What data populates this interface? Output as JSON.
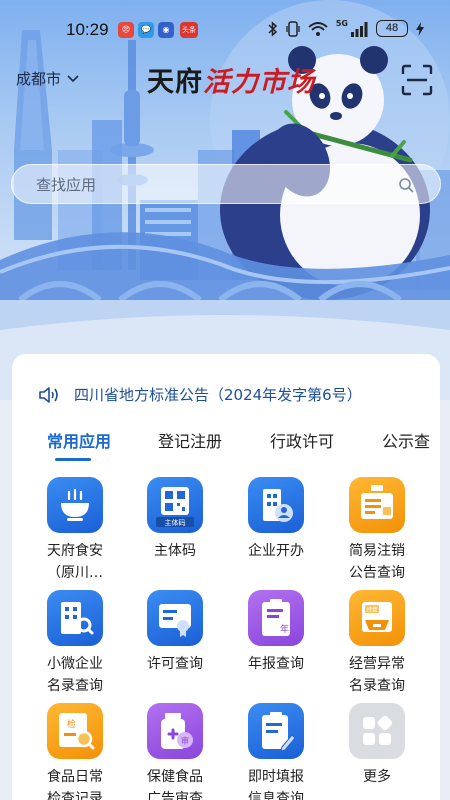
{
  "status_bar": {
    "time": "10:29",
    "notification_badges": [
      "",
      "",
      "",
      "头条"
    ],
    "network": "5G",
    "battery": "48"
  },
  "header": {
    "city": "成都市",
    "brand_black": "天府",
    "brand_red": "活力市场"
  },
  "search": {
    "placeholder": "查找应用"
  },
  "announcement": {
    "text": "四川省地方标准公告（2024年发字第6号）"
  },
  "tabs": [
    {
      "label": "常用应用",
      "active": true
    },
    {
      "label": "登记注册",
      "active": false
    },
    {
      "label": "行政许可",
      "active": false
    },
    {
      "label": "公示查",
      "active": false
    }
  ],
  "apps": [
    {
      "label": "天府食安\n（原川…",
      "icon": "food-bowl-icon",
      "color": "#2f7ee8"
    },
    {
      "label": "主体码",
      "icon": "qr-code-icon",
      "icon_text": "主体码",
      "color": "#2f7ee8"
    },
    {
      "label": "企业开办",
      "icon": "building-person-icon",
      "color": "#2f7ee8"
    },
    {
      "label": "简易注销\n公告查询",
      "icon": "signboard-icon",
      "color": "#f7a01d"
    },
    {
      "label": "小微企业\n名录查询",
      "icon": "building-search-icon",
      "color": "#2f7ee8"
    },
    {
      "label": "许可查询",
      "icon": "certificate-icon",
      "color": "#2f7ee8"
    },
    {
      "label": "年报查询",
      "icon": "annual-report-icon",
      "icon_text": "年",
      "color": "#9b59e6"
    },
    {
      "label": "经营异常\n名录查询",
      "icon": "business-box-icon",
      "icon_text": "经营",
      "color": "#f7a01d"
    },
    {
      "label": "食品日常\n检查记录",
      "icon": "inspection-search-icon",
      "icon_text": "检",
      "color": "#f7a01d"
    },
    {
      "label": "保健食品\n广告审查",
      "icon": "medicine-review-icon",
      "icon_text": "审",
      "color": "#9b59e6"
    },
    {
      "label": "即时填报\n信息查询",
      "icon": "clipboard-edit-icon",
      "color": "#2f7ee8"
    },
    {
      "label": "更多",
      "icon": "more-grid-icon",
      "color": "#d9dce1"
    }
  ]
}
